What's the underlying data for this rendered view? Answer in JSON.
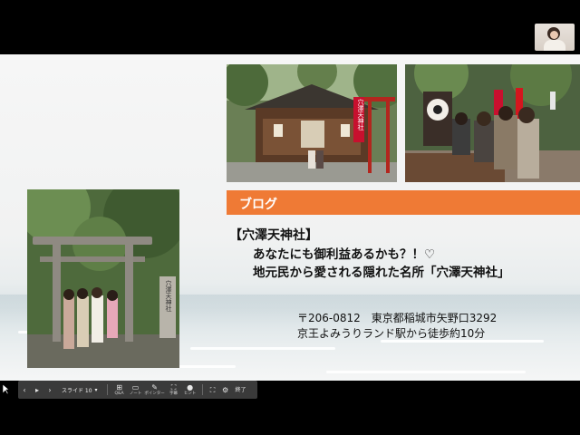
{
  "slide": {
    "banner_title": "ブログ",
    "shrine_name": "【穴澤天神社】",
    "line1": "あなたにも御利益あるかも？！♡",
    "line2": "地元民から愛される隠れた名所「穴澤天神社」",
    "address": "〒206-0812　東京都稲城市矢野口3292",
    "access": "京王よみうりランド駅から徒歩約10分"
  },
  "photo_signs": {
    "banner_sign": "穴澤天神社",
    "stone_marker": "穴澤天神社"
  },
  "toolbar": {
    "slide_select": "スライド 10",
    "buttons": [
      {
        "glyph": "⊞",
        "label": "Q&A"
      },
      {
        "glyph": "▭",
        "label": "ノート"
      },
      {
        "glyph": "✎",
        "label": "ポインター"
      },
      {
        "glyph": "⛶",
        "label": "字幕"
      },
      {
        "glyph": "●",
        "label": "ヒント"
      }
    ],
    "end_label": "終了"
  },
  "colors": {
    "banner": "#ef7a35",
    "toolbar": "#3a3a3a",
    "frame": "#000000"
  },
  "icons": [
    "previous-icon",
    "play-icon",
    "next-icon",
    "chevron-down-icon",
    "qa-icon",
    "notes-icon",
    "pointer-icon",
    "captions-icon",
    "hint-icon",
    "fullscreen-icon",
    "settings-icon",
    "cursor-icon"
  ]
}
